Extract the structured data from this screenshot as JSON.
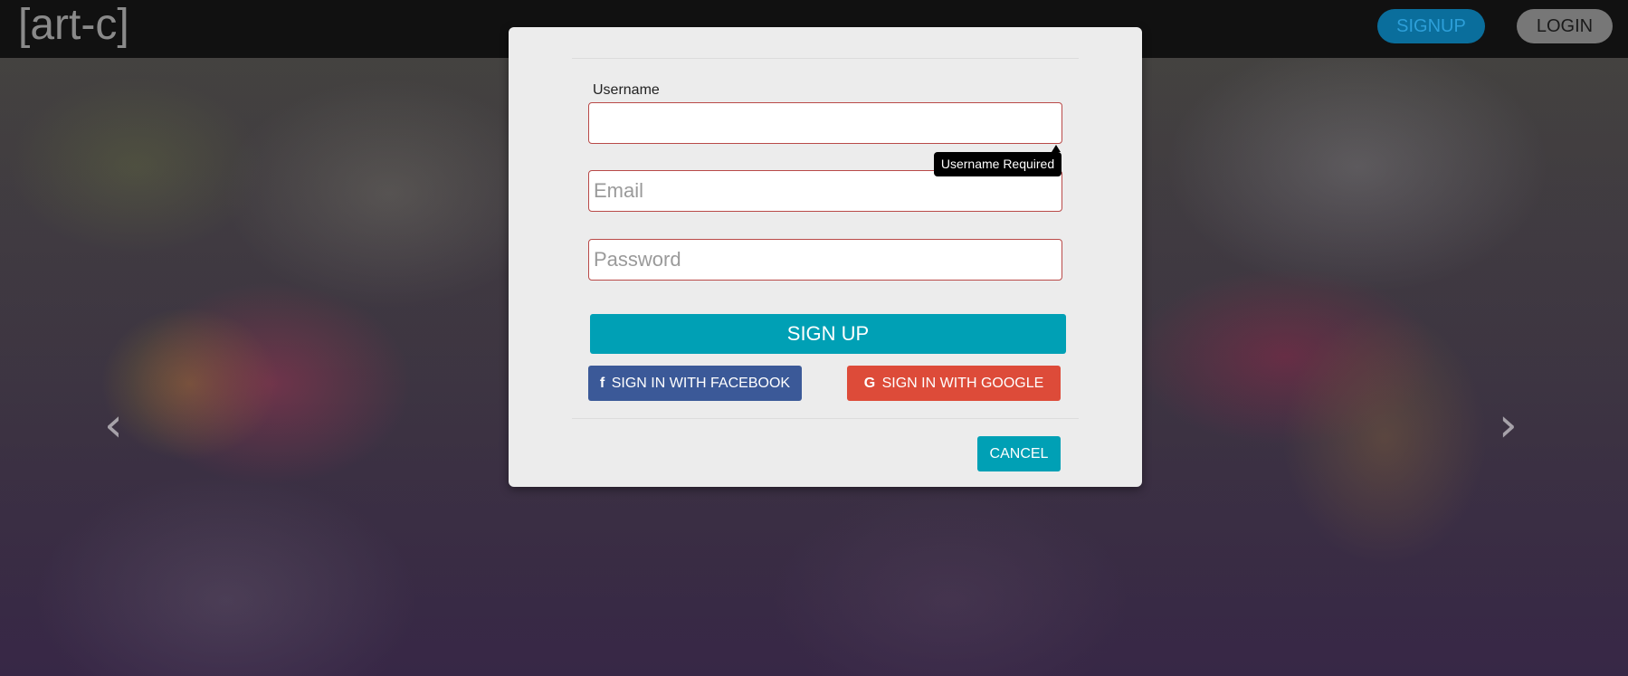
{
  "header": {
    "brand": "[art-c]",
    "signup_label": "SIGNUP",
    "login_label": "LOGIN"
  },
  "carousel": {
    "prev_icon": "chevron-left-icon",
    "next_icon": "chevron-right-icon"
  },
  "modal": {
    "username_label": "Username",
    "username_value": "",
    "email_placeholder": "Email",
    "password_placeholder": "Password",
    "tooltip": "Username Required",
    "signup_button": "SIGN UP",
    "facebook_button": "SIGN IN WITH FACEBOOK",
    "google_button": "SIGN IN WITH GOOGLE",
    "cancel_button": "CANCEL"
  },
  "colors": {
    "accent": "#00a0b5",
    "facebook": "#3b5998",
    "google": "#dd4b39",
    "error_border": "#b94a48"
  }
}
